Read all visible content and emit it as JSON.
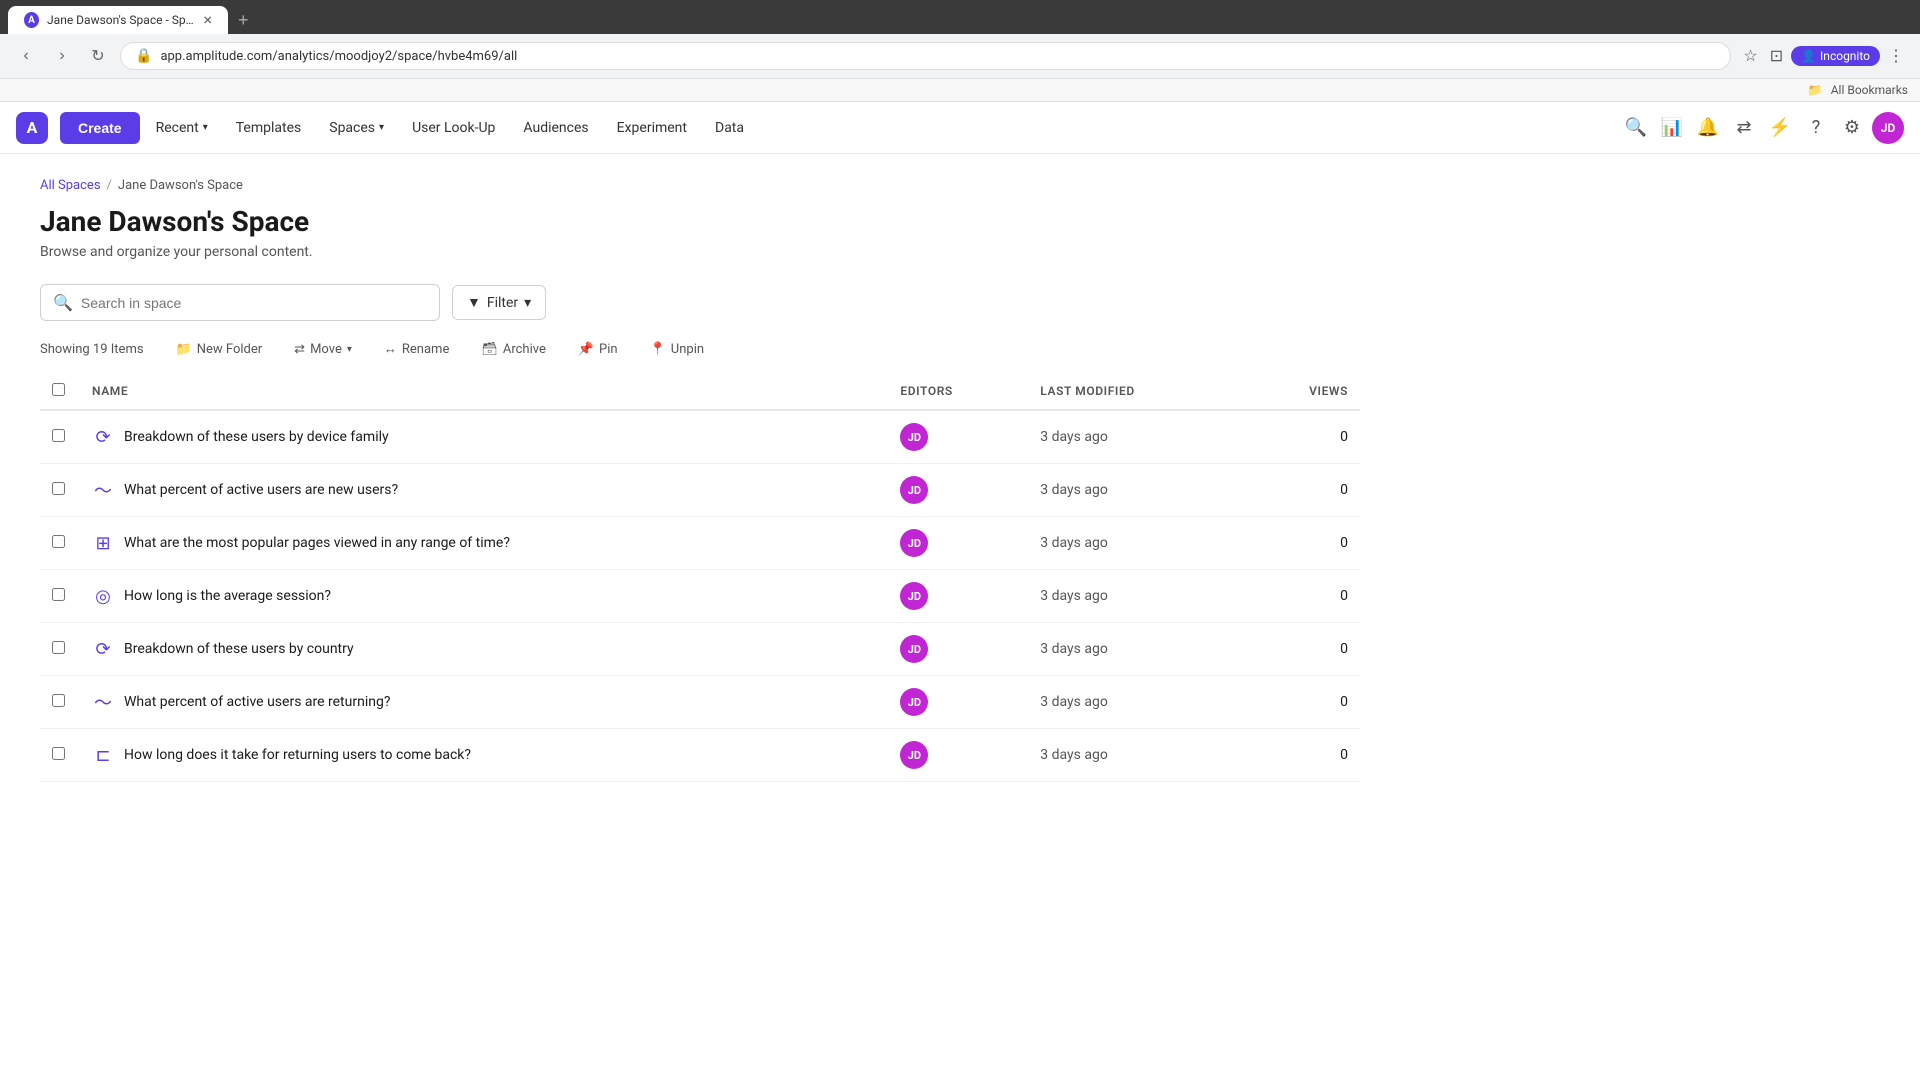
{
  "browser": {
    "tab_title": "Jane Dawson's Space - Space",
    "tab_favicon": "A",
    "url": "app.amplitude.com/analytics/moodjoy2/space/hvbe4m69/all",
    "incognito_label": "Incognito",
    "bookmarks_label": "All Bookmarks"
  },
  "nav": {
    "logo_text": "A",
    "create_label": "Create",
    "items": [
      {
        "label": "Recent",
        "has_dropdown": true
      },
      {
        "label": "Templates",
        "has_dropdown": false
      },
      {
        "label": "Spaces",
        "has_dropdown": true
      },
      {
        "label": "User Look-Up",
        "has_dropdown": false
      },
      {
        "label": "Audiences",
        "has_dropdown": false
      },
      {
        "label": "Experiment",
        "has_dropdown": false
      },
      {
        "label": "Data",
        "has_dropdown": false
      }
    ],
    "user_initials": "JD"
  },
  "breadcrumb": {
    "all_spaces_label": "All Spaces",
    "separator": "/",
    "current_space": "Jane Dawson's Space"
  },
  "page": {
    "title": "Jane Dawson's Space",
    "subtitle": "Browse and organize your personal content."
  },
  "search": {
    "placeholder": "Search in space"
  },
  "filter_btn": {
    "label": "Filter",
    "icon": "▾"
  },
  "toolbar": {
    "showing_label": "Showing 19 Items",
    "new_folder_label": "New Folder",
    "move_label": "Move",
    "rename_label": "Rename",
    "archive_label": "Archive",
    "pin_label": "Pin",
    "unpin_label": "Unpin"
  },
  "table": {
    "headers": {
      "name": "NAME",
      "editors": "EDITORS",
      "last_modified": "LAST MODIFIED",
      "views": "VIEWS"
    },
    "rows": [
      {
        "icon": "⟳",
        "icon_type": "segment",
        "name": "Breakdown of these users by device family",
        "editor_initials": "JD",
        "last_modified": "3 days ago",
        "views": "0"
      },
      {
        "icon": "∿",
        "icon_type": "trend",
        "name": "What percent of active users are new users?",
        "editor_initials": "JD",
        "last_modified": "3 days ago",
        "views": "0"
      },
      {
        "icon": "⊞",
        "icon_type": "table",
        "name": "What are the most popular pages viewed in any range of time?",
        "editor_initials": "JD",
        "last_modified": "3 days ago",
        "views": "0"
      },
      {
        "icon": "◎",
        "icon_type": "retention",
        "name": "How long is the average session?",
        "editor_initials": "JD",
        "last_modified": "3 days ago",
        "views": "0"
      },
      {
        "icon": "⟳",
        "icon_type": "segment",
        "name": "Breakdown of these users by country",
        "editor_initials": "JD",
        "last_modified": "3 days ago",
        "views": "0"
      },
      {
        "icon": "∿",
        "icon_type": "trend",
        "name": "What percent of active users are returning?",
        "editor_initials": "JD",
        "last_modified": "3 days ago",
        "views": "0"
      },
      {
        "icon": "⌐",
        "icon_type": "funnel",
        "name": "How long does it take for returning users to come back?",
        "editor_initials": "JD",
        "last_modified": "3 days ago",
        "views": "0"
      }
    ]
  }
}
